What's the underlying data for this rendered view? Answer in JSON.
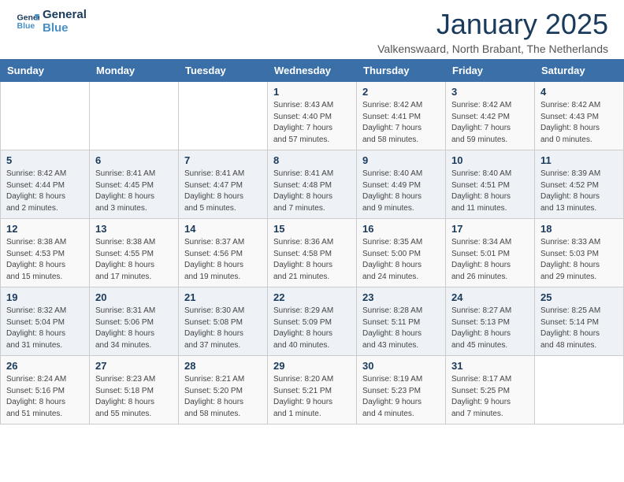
{
  "header": {
    "logo_line1": "General",
    "logo_line2": "Blue",
    "month_title": "January 2025",
    "location": "Valkenswaard, North Brabant, The Netherlands"
  },
  "weekdays": [
    "Sunday",
    "Monday",
    "Tuesday",
    "Wednesday",
    "Thursday",
    "Friday",
    "Saturday"
  ],
  "weeks": [
    [
      {
        "day": "",
        "info": ""
      },
      {
        "day": "",
        "info": ""
      },
      {
        "day": "",
        "info": ""
      },
      {
        "day": "1",
        "info": "Sunrise: 8:43 AM\nSunset: 4:40 PM\nDaylight: 7 hours\nand 57 minutes."
      },
      {
        "day": "2",
        "info": "Sunrise: 8:42 AM\nSunset: 4:41 PM\nDaylight: 7 hours\nand 58 minutes."
      },
      {
        "day": "3",
        "info": "Sunrise: 8:42 AM\nSunset: 4:42 PM\nDaylight: 7 hours\nand 59 minutes."
      },
      {
        "day": "4",
        "info": "Sunrise: 8:42 AM\nSunset: 4:43 PM\nDaylight: 8 hours\nand 0 minutes."
      }
    ],
    [
      {
        "day": "5",
        "info": "Sunrise: 8:42 AM\nSunset: 4:44 PM\nDaylight: 8 hours\nand 2 minutes."
      },
      {
        "day": "6",
        "info": "Sunrise: 8:41 AM\nSunset: 4:45 PM\nDaylight: 8 hours\nand 3 minutes."
      },
      {
        "day": "7",
        "info": "Sunrise: 8:41 AM\nSunset: 4:47 PM\nDaylight: 8 hours\nand 5 minutes."
      },
      {
        "day": "8",
        "info": "Sunrise: 8:41 AM\nSunset: 4:48 PM\nDaylight: 8 hours\nand 7 minutes."
      },
      {
        "day": "9",
        "info": "Sunrise: 8:40 AM\nSunset: 4:49 PM\nDaylight: 8 hours\nand 9 minutes."
      },
      {
        "day": "10",
        "info": "Sunrise: 8:40 AM\nSunset: 4:51 PM\nDaylight: 8 hours\nand 11 minutes."
      },
      {
        "day": "11",
        "info": "Sunrise: 8:39 AM\nSunset: 4:52 PM\nDaylight: 8 hours\nand 13 minutes."
      }
    ],
    [
      {
        "day": "12",
        "info": "Sunrise: 8:38 AM\nSunset: 4:53 PM\nDaylight: 8 hours\nand 15 minutes."
      },
      {
        "day": "13",
        "info": "Sunrise: 8:38 AM\nSunset: 4:55 PM\nDaylight: 8 hours\nand 17 minutes."
      },
      {
        "day": "14",
        "info": "Sunrise: 8:37 AM\nSunset: 4:56 PM\nDaylight: 8 hours\nand 19 minutes."
      },
      {
        "day": "15",
        "info": "Sunrise: 8:36 AM\nSunset: 4:58 PM\nDaylight: 8 hours\nand 21 minutes."
      },
      {
        "day": "16",
        "info": "Sunrise: 8:35 AM\nSunset: 5:00 PM\nDaylight: 8 hours\nand 24 minutes."
      },
      {
        "day": "17",
        "info": "Sunrise: 8:34 AM\nSunset: 5:01 PM\nDaylight: 8 hours\nand 26 minutes."
      },
      {
        "day": "18",
        "info": "Sunrise: 8:33 AM\nSunset: 5:03 PM\nDaylight: 8 hours\nand 29 minutes."
      }
    ],
    [
      {
        "day": "19",
        "info": "Sunrise: 8:32 AM\nSunset: 5:04 PM\nDaylight: 8 hours\nand 31 minutes."
      },
      {
        "day": "20",
        "info": "Sunrise: 8:31 AM\nSunset: 5:06 PM\nDaylight: 8 hours\nand 34 minutes."
      },
      {
        "day": "21",
        "info": "Sunrise: 8:30 AM\nSunset: 5:08 PM\nDaylight: 8 hours\nand 37 minutes."
      },
      {
        "day": "22",
        "info": "Sunrise: 8:29 AM\nSunset: 5:09 PM\nDaylight: 8 hours\nand 40 minutes."
      },
      {
        "day": "23",
        "info": "Sunrise: 8:28 AM\nSunset: 5:11 PM\nDaylight: 8 hours\nand 43 minutes."
      },
      {
        "day": "24",
        "info": "Sunrise: 8:27 AM\nSunset: 5:13 PM\nDaylight: 8 hours\nand 45 minutes."
      },
      {
        "day": "25",
        "info": "Sunrise: 8:25 AM\nSunset: 5:14 PM\nDaylight: 8 hours\nand 48 minutes."
      }
    ],
    [
      {
        "day": "26",
        "info": "Sunrise: 8:24 AM\nSunset: 5:16 PM\nDaylight: 8 hours\nand 51 minutes."
      },
      {
        "day": "27",
        "info": "Sunrise: 8:23 AM\nSunset: 5:18 PM\nDaylight: 8 hours\nand 55 minutes."
      },
      {
        "day": "28",
        "info": "Sunrise: 8:21 AM\nSunset: 5:20 PM\nDaylight: 8 hours\nand 58 minutes."
      },
      {
        "day": "29",
        "info": "Sunrise: 8:20 AM\nSunset: 5:21 PM\nDaylight: 9 hours\nand 1 minute."
      },
      {
        "day": "30",
        "info": "Sunrise: 8:19 AM\nSunset: 5:23 PM\nDaylight: 9 hours\nand 4 minutes."
      },
      {
        "day": "31",
        "info": "Sunrise: 8:17 AM\nSunset: 5:25 PM\nDaylight: 9 hours\nand 7 minutes."
      },
      {
        "day": "",
        "info": ""
      }
    ]
  ]
}
